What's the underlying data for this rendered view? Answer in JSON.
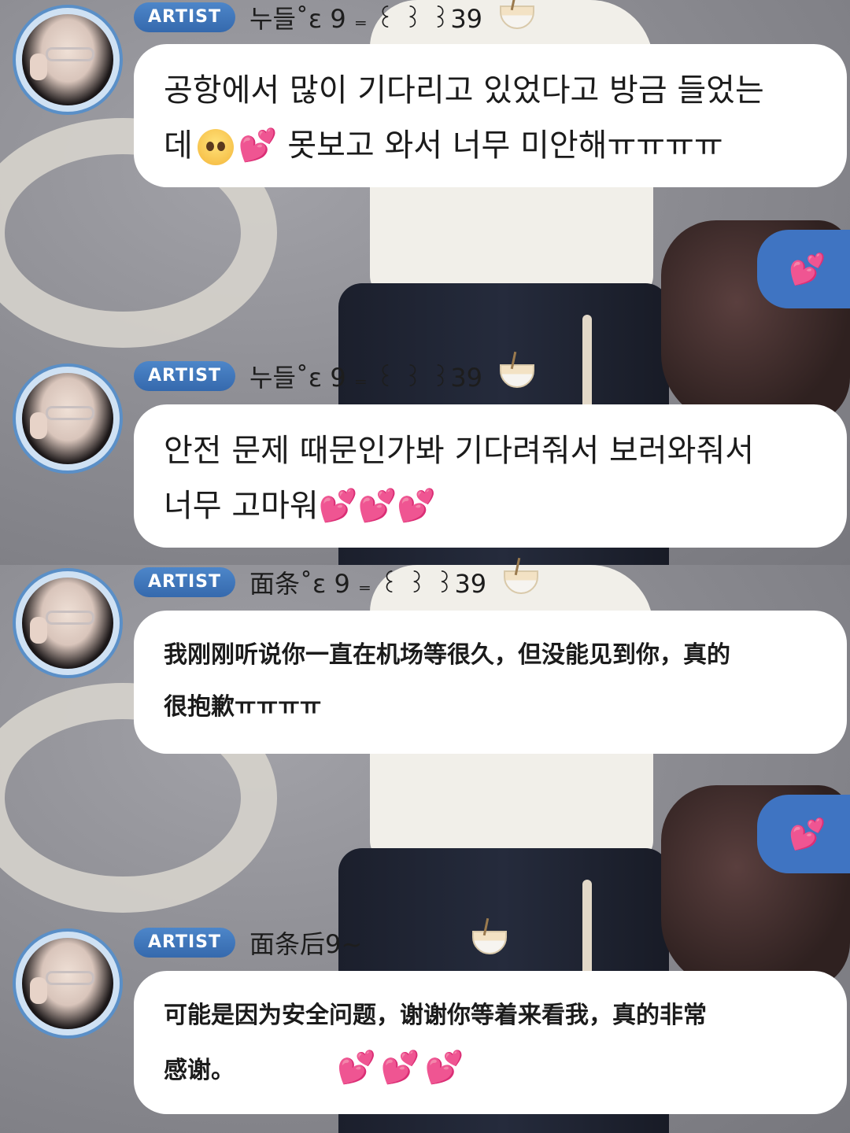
{
  "messages": [
    {
      "badge": "ARTIST",
      "username": "누들˚ɛ 9 ₌ ꒰ ꒱ ꒱39",
      "icon": "noodle-bowl-icon",
      "text_line1": "공항에서 많이 기다리고 있었다고 방금 들었는",
      "text_line2_a": "데",
      "text_line2_b": "💕 못보고 와서 너무 미안해ㅠㅠㅠㅠ",
      "emoji": "pleading-face-icon"
    },
    {
      "badge": "ARTIST",
      "username": "누들˚ɛ 9 ₌ ꒰ ꒱ ꒱39",
      "icon": "noodle-bowl-icon",
      "text_line1": "안전 문제 때문인가봐 기다려줘서 보러와줘서",
      "text_line2": "너무 고마워💕💕💕"
    },
    {
      "badge": "ARTIST",
      "username": "面条˚ɛ 9 ₌ ꒰ ꒱ ꒱39",
      "icon": "noodle-bowl-icon",
      "text_line1": "我刚刚听说你一直在机场等很久，但没能见到你，真的",
      "text_line2": "很抱歉ㅠㅠㅠㅠ"
    },
    {
      "badge": "ARTIST",
      "username": "面条后9~",
      "icon": "noodle-bowl-icon",
      "text_line1": "可能是因为安全问题，谢谢你等着来看我，真的非常",
      "text_line2": "感谢。",
      "hearts": "💕💕💕"
    }
  ],
  "fan_replies": [
    "💕",
    "💕"
  ],
  "colors": {
    "badge": "#3f78bf",
    "bubble": "#ffffff",
    "hearts": "#e0479b",
    "fan_bubble": "#3f74c2"
  }
}
